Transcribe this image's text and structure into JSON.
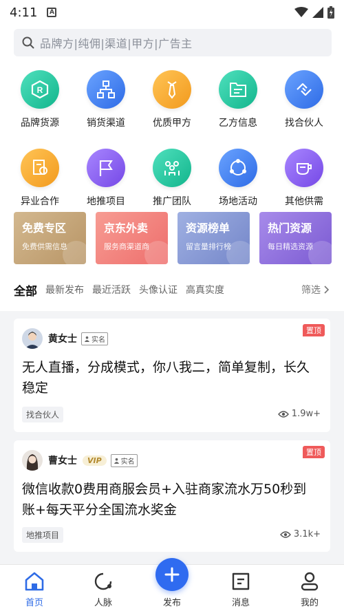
{
  "status_bar": {
    "time": "4:11"
  },
  "search": {
    "placeholder": "品牌方|纯佣|渠道|甲方|广告主"
  },
  "categories_row1": [
    {
      "label": "品牌货源",
      "icon": "brand-icon",
      "color": "#1fc8a0"
    },
    {
      "label": "销货渠道",
      "icon": "channel-icon",
      "color": "#3a7bf2"
    },
    {
      "label": "优质甲方",
      "icon": "tie-icon",
      "color": "#f7a32a"
    },
    {
      "label": "乙方信息",
      "icon": "folder-icon",
      "color": "#1fc8a0"
    },
    {
      "label": "找合伙人",
      "icon": "handshake-icon",
      "color": "#3a7bf2"
    }
  ],
  "categories_row2": [
    {
      "label": "异业合作",
      "icon": "document-icon",
      "color": "#f7a32a"
    },
    {
      "label": "地推项目",
      "icon": "flag-icon",
      "color": "#8b5cf6"
    },
    {
      "label": "推广团队",
      "icon": "team-icon",
      "color": "#1fc8a0"
    },
    {
      "label": "场地活动",
      "icon": "share-icon",
      "color": "#3a7bf2"
    },
    {
      "label": "其他供需",
      "icon": "cup-icon",
      "color": "#8b5cf6"
    }
  ],
  "banners": [
    {
      "title": "免费专区",
      "subtitle": "免费供需信息",
      "color": "#c8a87c"
    },
    {
      "title": "京东外卖",
      "subtitle": "服务商渠道商",
      "color": "#f0837f"
    },
    {
      "title": "资源榜单",
      "subtitle": "留言量排行榜",
      "color": "#8a9bd6"
    },
    {
      "title": "热门资源",
      "subtitle": "每日精选资源",
      "color": "#8f6fd8"
    }
  ],
  "filters": {
    "active": "全部",
    "items": [
      "最新发布",
      "最近活跃",
      "头像认证",
      "高真实度"
    ],
    "more": "筛选"
  },
  "posts": [
    {
      "user": "黄女士",
      "verified": "实名",
      "pinned": "置顶",
      "title": "无人直播，分成模式，你八我二，简单复制，长久稳定",
      "tag": "找合伙人",
      "views": "1.9w+"
    },
    {
      "user": "曹女士",
      "vip": "VIP",
      "verified": "实名",
      "pinned": "置顶",
      "title": "微信收款0费用商服会员+入驻商家流水万50秒到账+每天平分全国流水奖金",
      "tag": "地推项目",
      "views": "3.1k+"
    }
  ],
  "tabbar": {
    "home": "首页",
    "contacts": "人脉",
    "publish": "发布",
    "messages": "消息",
    "mine": "我的",
    "active_color": "#2e6be6"
  }
}
